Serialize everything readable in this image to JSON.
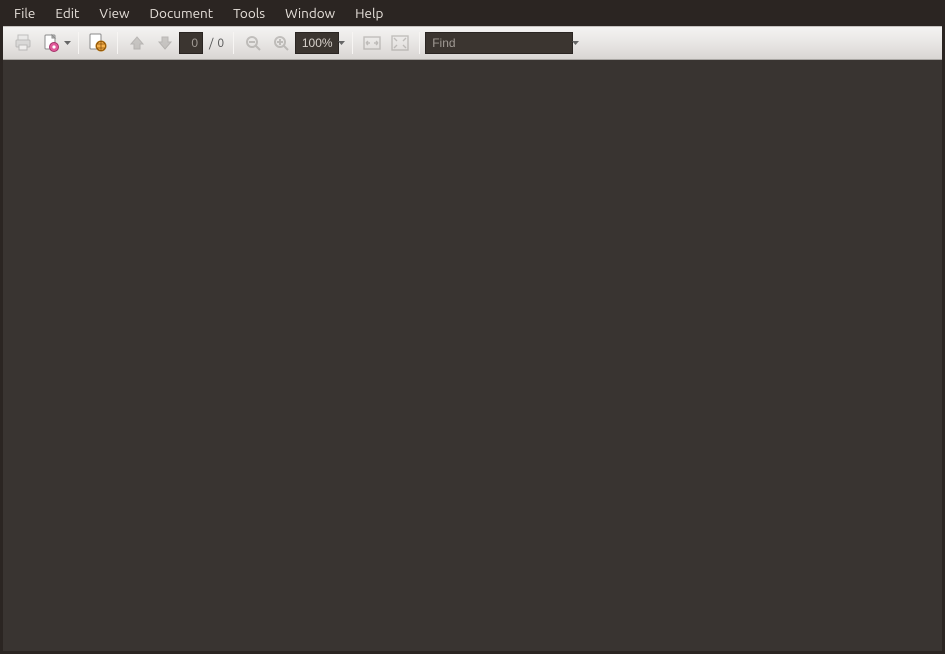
{
  "menus": {
    "file": "File",
    "edit": "Edit",
    "view": "View",
    "document": "Document",
    "tools": "Tools",
    "window": "Window",
    "help": "Help"
  },
  "toolbar": {
    "page_current": "0",
    "page_sep": "/",
    "page_total": "0",
    "zoom_value": "100%",
    "find_placeholder": "Find"
  }
}
